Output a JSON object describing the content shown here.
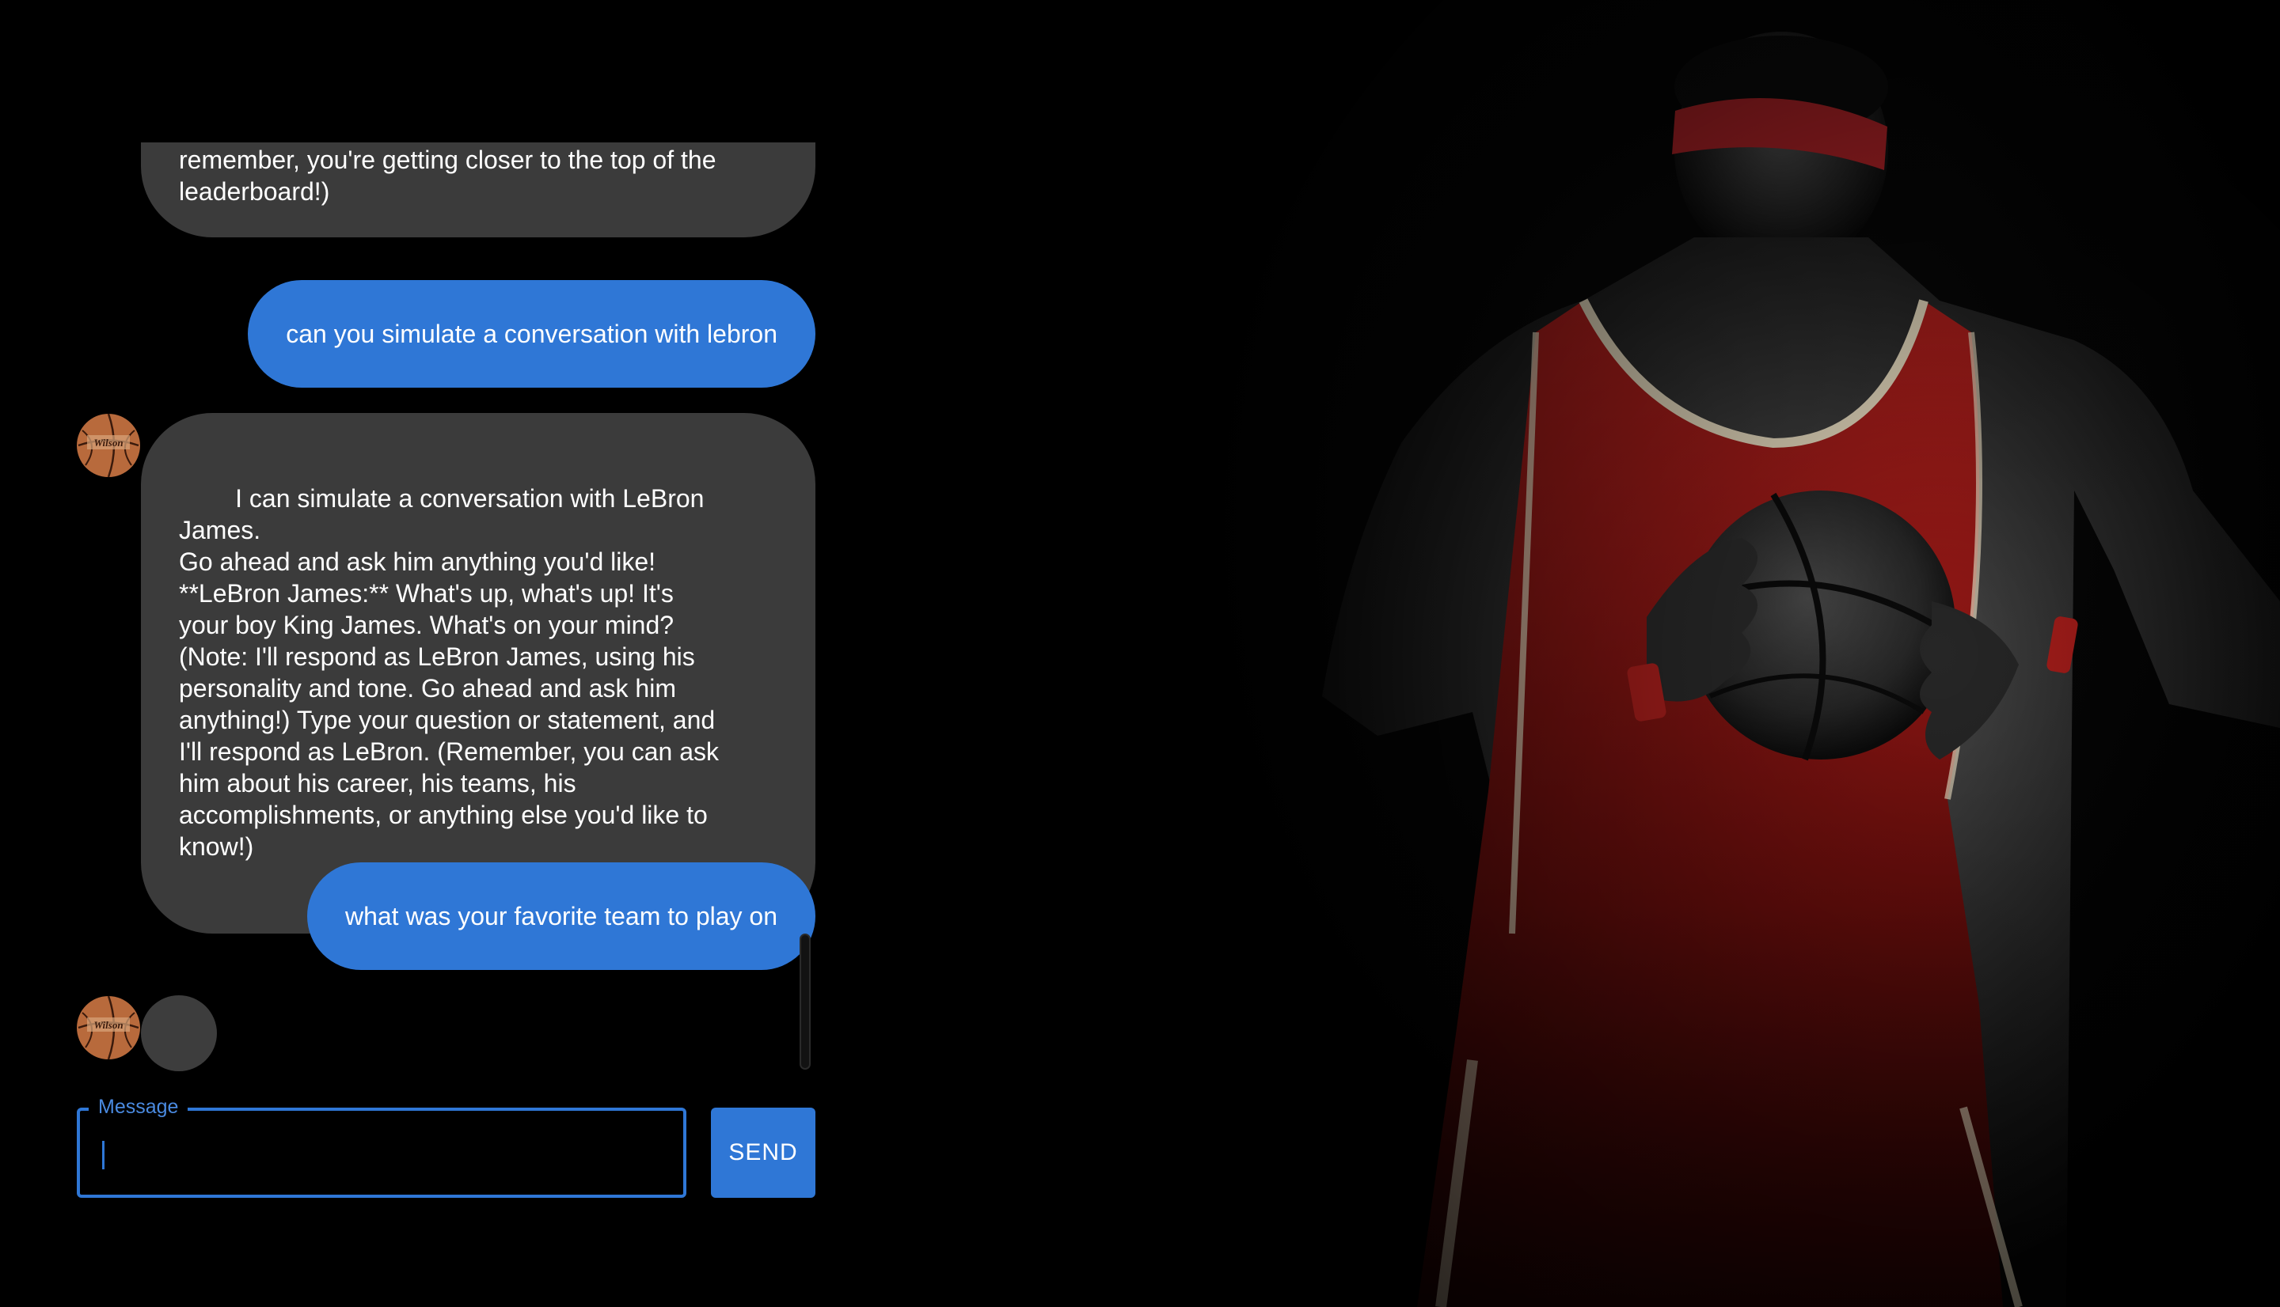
{
  "colors": {
    "background": "#000000",
    "bot_bubble": "#3b3b3b",
    "user_bubble": "#2f77d6",
    "accent": "#2f77d6"
  },
  "messages": [
    {
      "role": "bot",
      "text": "Popovich. Let me know your answer! (And\nremember, you're getting closer to the top of the\nleaderboard!)",
      "avatar": "basketball-avatar"
    },
    {
      "role": "user",
      "text": "can you simulate a conversation with lebron"
    },
    {
      "role": "bot",
      "text": "I can simulate a conversation with LeBron James.\nGo ahead and ask him anything you'd like!\n**LeBron James:** What's up, what's up! It's\nyour boy King James. What's on your mind?\n(Note: I'll respond as LeBron James, using his\npersonality and tone. Go ahead and ask him\nanything!) Type your question or statement, and\nI'll respond as LeBron. (Remember, you can ask\nhim about his career, his teams, his\naccomplishments, or anything else you'd like to\nknow!)",
      "avatar": "basketball-avatar"
    },
    {
      "role": "user",
      "text": "what was your favorite team to play on"
    }
  ],
  "typing_indicator": {
    "avatar": "basketball-avatar"
  },
  "composer": {
    "label": "Message",
    "value": "",
    "send_label": "SEND"
  },
  "hero": {
    "subject": "basketball player in red jersey holding a basketball",
    "icon": "hero-player-image"
  }
}
